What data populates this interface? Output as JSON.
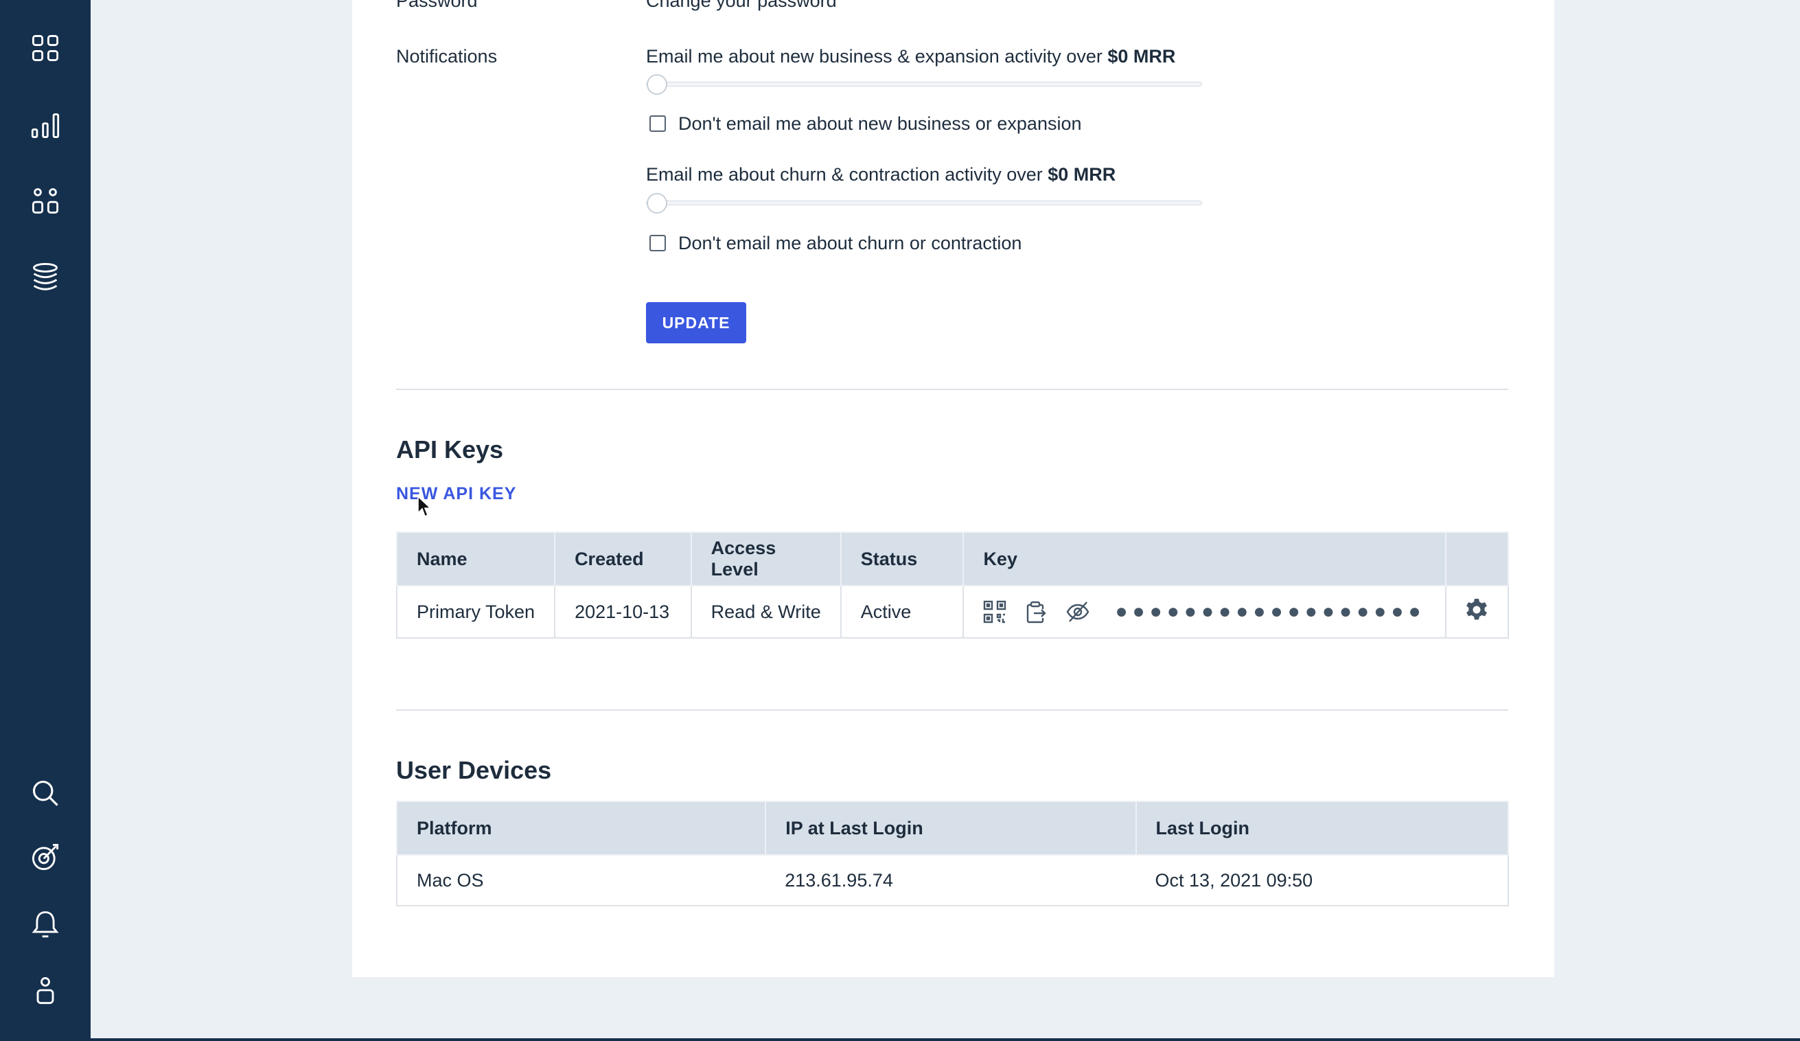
{
  "sidebar": {
    "top_icons": [
      "dashboard-icon",
      "bar-chart-icon",
      "segments-icon",
      "database-icon"
    ],
    "bottom_icons": [
      "search-icon",
      "goals-icon",
      "bell-icon",
      "user-icon"
    ]
  },
  "settings": {
    "password_label": "Password",
    "password_link": "Change your password",
    "notifications_label": "Notifications",
    "expansion_prefix": "Email me about new business & expansion activity over ",
    "expansion_value": "$0 MRR",
    "expansion_slider_value": 0,
    "expansion_checkbox_label": "Don't email me about new business or expansion",
    "churn_prefix": "Email me about churn & contraction activity over ",
    "churn_value": "$0 MRR",
    "churn_slider_value": 0,
    "churn_checkbox_label": "Don't email me about churn or contraction",
    "update_button": "UPDATE"
  },
  "api_keys": {
    "title": "API Keys",
    "new_key_link": "NEW API KEY",
    "columns": [
      "Name",
      "Created",
      "Access Level",
      "Status",
      "Key"
    ],
    "rows": [
      {
        "name": "Primary Token",
        "created": "2021-10-13",
        "access_level": "Read & Write",
        "status": "Active",
        "key_masked": "●●●●●●●●●●●●●●●●●●"
      }
    ]
  },
  "user_devices": {
    "title": "User Devices",
    "columns": [
      "Platform",
      "IP at Last Login",
      "Last Login"
    ],
    "rows": [
      {
        "platform": "Mac OS",
        "ip": "213.61.95.74",
        "last_login": "Oct 13, 2021 09:50"
      }
    ]
  },
  "colors": {
    "sidebar": "#15304d",
    "accent": "#3a57e0",
    "table_header": "#d7dfe9"
  }
}
